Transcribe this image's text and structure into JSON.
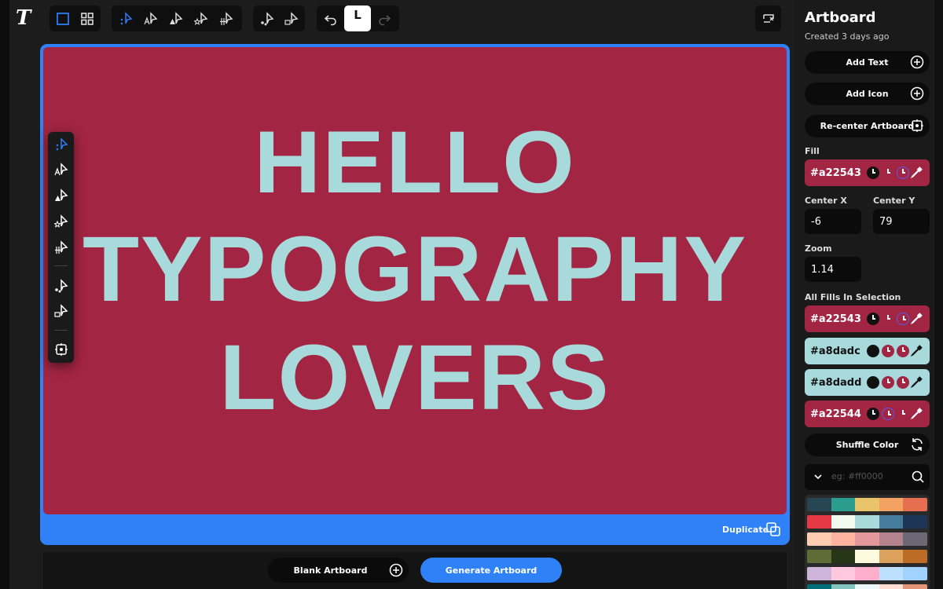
{
  "toolbar": {
    "logo": "T",
    "groups": [
      [
        "select-single",
        "select-grid"
      ],
      [
        "tool-1",
        "tool-2",
        "tool-3",
        "tool-4",
        "tool-5"
      ],
      [
        "tool-6",
        "tool-7"
      ],
      [
        "undo",
        "layout",
        "redo"
      ]
    ],
    "layout_letter": "L"
  },
  "artboard": {
    "fill": "#a22543",
    "text_color": "#a8dadc",
    "lines": [
      "HELLO",
      "TYPOGRAPHY",
      "LOVERS"
    ],
    "duplicate_label": "Duplicate"
  },
  "bottom": {
    "blank_label": "Blank Artboard",
    "generate_label": "Generate Artboard"
  },
  "panel": {
    "title": "Artboard",
    "subtitle": "Created 3 days ago",
    "add_text": "Add Text",
    "add_icon": "Add Icon",
    "recenter": "Re-center Artboard",
    "fill_label": "Fill",
    "fill_value": "#a22543",
    "center_x_label": "Center X",
    "center_x": "-6",
    "center_y_label": "Center Y",
    "center_y": "79",
    "zoom_label": "Zoom",
    "zoom": "1.14",
    "all_fills_label": "All Fills In Selection",
    "fills": [
      {
        "hex": "#a22543",
        "bg": "#a22543",
        "fg": "#ffffff"
      },
      {
        "hex": "#a8dadc",
        "bg": "#a8dadc",
        "fg": "#111111"
      },
      {
        "hex": "#a8dadd",
        "bg": "#a8dadd",
        "fg": "#111111"
      },
      {
        "hex": "#a22544",
        "bg": "#a22544",
        "fg": "#ffffff"
      }
    ],
    "shuffle": "Shuffle Color",
    "search_placeholder": "eg: #ff0000",
    "palettes": [
      [
        "#264653",
        "#2a9d8f",
        "#e9c46a",
        "#f4a261",
        "#e76f51"
      ],
      [
        "#e63946",
        "#f1faee",
        "#a8dadc",
        "#457b9d",
        "#1d3557"
      ],
      [
        "#ffcdb2",
        "#ffb4a2",
        "#e5989b",
        "#b5838d",
        "#6d6875"
      ],
      [
        "#606c38",
        "#283618",
        "#fefae0",
        "#dda15e",
        "#bc6c25"
      ],
      [
        "#cdb4db",
        "#ffc8dd",
        "#ffafcc",
        "#bde0fe",
        "#a2d2ff"
      ],
      [
        "#006d77",
        "#83c5be",
        "#edf6f9",
        "#ffddd2",
        "#e29578"
      ]
    ]
  }
}
